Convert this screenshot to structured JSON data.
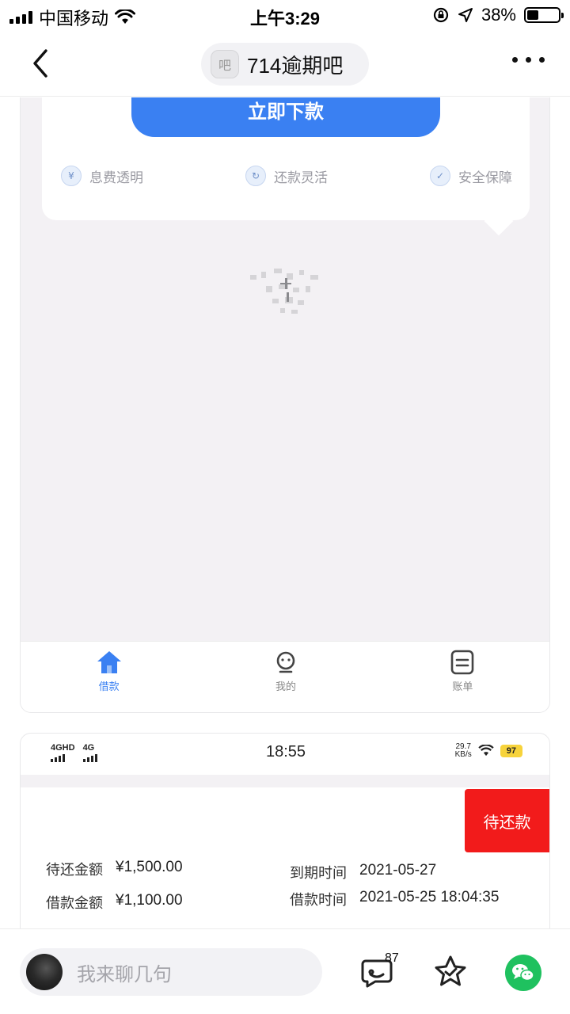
{
  "status_bar": {
    "carrier": "中国移动",
    "time": "上午3:29",
    "battery_text": "38%",
    "battery_level": 0.38
  },
  "nav": {
    "title": "714逾期吧",
    "badge_char": "吧"
  },
  "screenshot1": {
    "download_button": "立即下款",
    "features": [
      {
        "label": "息费透明",
        "icon": "fee-icon"
      },
      {
        "label": "还款灵活",
        "icon": "repay-icon"
      },
      {
        "label": "安全保障",
        "icon": "shield-icon"
      }
    ],
    "tabs": [
      {
        "label": "借款",
        "icon": "home-icon",
        "active": true
      },
      {
        "label": "我的",
        "icon": "profile-icon",
        "active": false
      },
      {
        "label": "账单",
        "icon": "bill-icon",
        "active": false
      }
    ]
  },
  "screenshot2": {
    "status": {
      "net1": "4GHD",
      "net2": "4G",
      "time": "18:55",
      "speed_value": "29.7",
      "speed_unit": "KB/s",
      "battery": "97"
    },
    "pending_label": "待还款",
    "fields": {
      "due_amount_label": "待还金额",
      "due_amount": "¥1,500.00",
      "loan_amount_label": "借款金额",
      "loan_amount": "¥1,100.00",
      "due_date_label": "到期时间",
      "due_date": "2021-05-27",
      "loan_time_label": "借款时间",
      "loan_time": "2021-05-25 18:04:35"
    }
  },
  "bottom_bar": {
    "comment_placeholder": "我来聊几句",
    "comment_count": "87"
  },
  "colors": {
    "accent_blue": "#3a80f2",
    "pending_red": "#f21b1b",
    "wechat_green": "#1fc15f"
  }
}
